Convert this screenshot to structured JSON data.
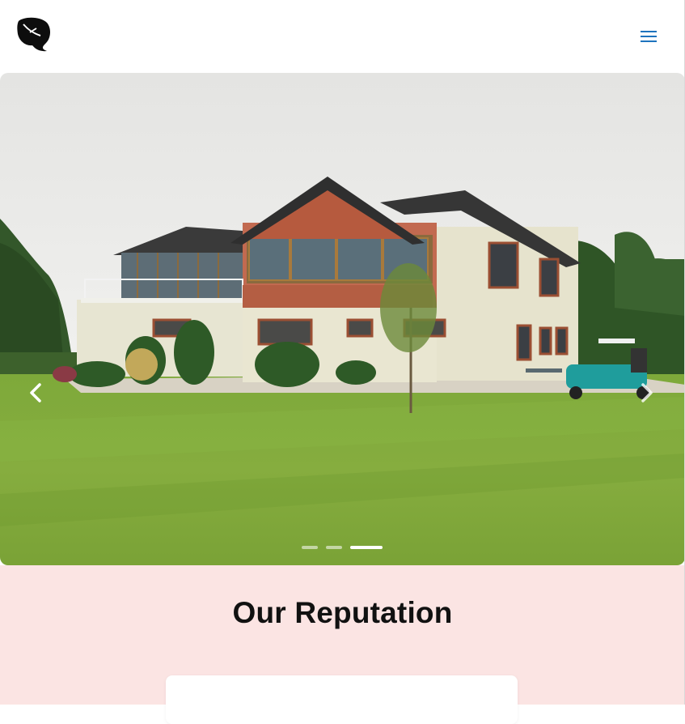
{
  "header": {
    "logo_icon": "leaf-logo-icon",
    "menu_icon": "hamburger-menu-icon",
    "menu_color": "#1e73be"
  },
  "hero": {
    "image_subject": "clubhouse-building-photo",
    "prev_icon": "chevron-left-icon",
    "next_icon": "chevron-right-icon",
    "slide_count": 3,
    "active_slide": 3
  },
  "reputation": {
    "title": "Our Reputation",
    "background": "#fbe4e3"
  }
}
